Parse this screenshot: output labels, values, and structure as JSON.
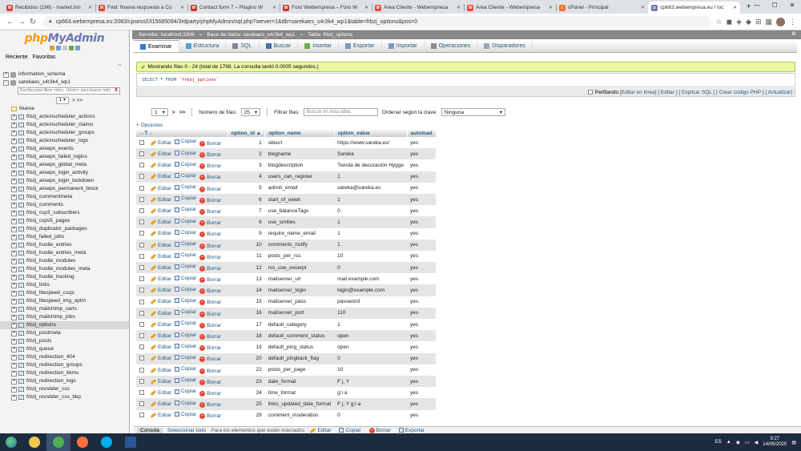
{
  "browser": {
    "tabs": [
      {
        "title": "Recibidos (196) - market.inn",
        "fav": "M",
        "color": "#d44638"
      },
      {
        "title": "Fwd: Nueva respuesta a Co",
        "fav": "M",
        "color": "#d44638"
      },
      {
        "title": "Contact form 7 – Plugins W",
        "fav": "W",
        "color": "#c0392b"
      },
      {
        "title": "Foro Webempresa – Foro W",
        "fav": "W",
        "color": "#c0392b"
      },
      {
        "title": "Área Cliente - Webempresa",
        "fav": "W",
        "color": "#e8493c"
      },
      {
        "title": "Área Cliente - Webempresa",
        "fav": "W",
        "color": "#e8493c"
      },
      {
        "title": "cPanel - Principal",
        "fav": "c",
        "color": "#ff6c2c"
      },
      {
        "title": "cp663.webempresa.eu / loc",
        "fav": "p",
        "color": "#6c78af",
        "active": true
      }
    ],
    "new_tab": "+",
    "url": "cp663.webempresa.eu:2083/cpsess5315685094/3rdparty/phpMyAdmin/sql.php?server=1&db=sarekaes_s4r3k4_wp1&table=frbzj_options&pos=0"
  },
  "sidebar": {
    "logo_php": "php",
    "logo_my": "MyAdmin",
    "tab_recent": "Reciente",
    "tab_fav": "Favoritas",
    "link_icon": "⇔",
    "db_info": "information_schema",
    "db_main": "sarekaes_s4r3k4_wp1",
    "filter_placeholder": "Escriba para filtrar estos, «Enter» para buscar todo",
    "filter_clear": "X",
    "page_value": "1",
    "page_next": "> >>",
    "new_label": "Nueva",
    "tables": [
      "frbzj_actionscheduler_actions",
      "frbzj_actionscheduler_claims",
      "frbzj_actionscheduler_groups",
      "frbzj_actionscheduler_logs",
      "frbzj_aiowps_events",
      "frbzj_aiowps_failed_logins",
      "frbzj_aiowps_global_meta",
      "frbzj_aiowps_login_activity",
      "frbzj_aiowps_login_lockdown",
      "frbzj_aiowps_permanent_block",
      "frbzj_commentmeta",
      "frbzj_comments",
      "frbzj_csp3_subscribers",
      "frbzj_cspv5_pages",
      "frbzj_duplicator_packages",
      "frbzj_failed_jobs",
      "frbzj_hustle_entries",
      "frbzj_hustle_entries_meta",
      "frbzj_hustle_modules",
      "frbzj_hustle_modules_meta",
      "frbzj_hustle_tracking",
      "frbzj_links",
      "frbzj_litespeed_cssjs",
      "frbzj_litespeed_img_optm",
      "frbzj_mailchimp_carts",
      "frbzj_mailchimp_jobs",
      "frbzj_options",
      "frbzj_postmeta",
      "frbzj_posts",
      "frbzj_queue",
      "frbzj_redirection_404",
      "frbzj_redirection_groups",
      "frbzj_redirection_items",
      "frbzj_redirection_logs",
      "frbzj_revslider_css",
      "frbzj_revslider_css_bkp"
    ],
    "selected_table": "frbzj_options"
  },
  "breadcrumb": {
    "server": "Servidor: localhost:3306",
    "db": "Base de datos: sarekaes_s4r3k4_wp1",
    "table": "Tabla: frbzj_options",
    "sep": "»",
    "gear": "⚙"
  },
  "menu": [
    {
      "label": "Examinar",
      "color": "#2e7bcf"
    },
    {
      "label": "Estructura",
      "color": "#5aa0d8"
    },
    {
      "label": "SQL",
      "color": "#7d8a99"
    },
    {
      "label": "Buscar",
      "color": "#4b6fa8"
    },
    {
      "label": "Insertar",
      "color": "#6ab04c"
    },
    {
      "label": "Exportar",
      "color": "#7d9bc1"
    },
    {
      "label": "Importar",
      "color": "#7d9bc1"
    },
    {
      "label": "Operaciones",
      "color": "#8c8c8c"
    },
    {
      "label": "Disparadores",
      "color": "#9aa9bc"
    }
  ],
  "success_msg": "Mostrando filas 0 - 24 (total de 1768, La consulta tardó 0.0005 segundos.)",
  "success_check": "✔",
  "sql": {
    "kw1": "SELECT",
    "star": "*",
    "kw2": "FROM",
    "table": "`frbzj_options`"
  },
  "toolbar": {
    "perfilando": "Perfilando",
    "edit_inline": "[Editar en línea]",
    "edit": "[ Editar ]",
    "explain": "[ Explicar SQL ]",
    "php": "[ Crear código PHP ]",
    "refresh": "[ Actualizar]"
  },
  "nav": {
    "page": "1",
    "next": ">",
    "last": ">>",
    "rows_label": "Número de filas:",
    "rows_value": "25",
    "filter_label": "Filtrar filas:",
    "filter_placeholder": "Buscar en esta tabla",
    "sort_label": "Ordenar según la clave:",
    "sort_value": "Ninguna"
  },
  "opciones": "+ Opciones",
  "columns": {
    "arrows": "←T→",
    "id": "option_id",
    "name": "option_name",
    "value": "option_value",
    "autoload": "autoload",
    "sort": "▲"
  },
  "actions": {
    "edit": "Editar",
    "copy": "Copiar",
    "delete": "Borrar"
  },
  "rows": [
    {
      "id": "1",
      "name": "siteurl",
      "value": "https://www.sareka.es/",
      "autoload": "yes"
    },
    {
      "id": "2",
      "name": "blogname",
      "value": "Sareka",
      "autoload": "yes"
    },
    {
      "id": "3",
      "name": "blogdescription",
      "value": "Tienda de decoración Hygge",
      "autoload": "yes"
    },
    {
      "id": "4",
      "name": "users_can_register",
      "value": "1",
      "autoload": "yes"
    },
    {
      "id": "5",
      "name": "admin_email",
      "value": "sareka@sareka.es",
      "autoload": "yes"
    },
    {
      "id": "6",
      "name": "start_of_week",
      "value": "1",
      "autoload": "yes"
    },
    {
      "id": "7",
      "name": "use_balanceTags",
      "value": "0",
      "autoload": "yes"
    },
    {
      "id": "8",
      "name": "use_smilies",
      "value": "1",
      "autoload": "yes"
    },
    {
      "id": "9",
      "name": "require_name_email",
      "value": "1",
      "autoload": "yes"
    },
    {
      "id": "10",
      "name": "comments_notify",
      "value": "1",
      "autoload": "yes"
    },
    {
      "id": "11",
      "name": "posts_per_rss",
      "value": "10",
      "autoload": "yes"
    },
    {
      "id": "12",
      "name": "rss_use_excerpt",
      "value": "0",
      "autoload": "yes"
    },
    {
      "id": "13",
      "name": "mailserver_url",
      "value": "mail.example.com",
      "autoload": "yes"
    },
    {
      "id": "14",
      "name": "mailserver_login",
      "value": "login@example.com",
      "autoload": "yes"
    },
    {
      "id": "15",
      "name": "mailserver_pass",
      "value": "password",
      "autoload": "yes"
    },
    {
      "id": "16",
      "name": "mailserver_port",
      "value": "110",
      "autoload": "yes"
    },
    {
      "id": "17",
      "name": "default_category",
      "value": "1",
      "autoload": "yes"
    },
    {
      "id": "18",
      "name": "default_comment_status",
      "value": "open",
      "autoload": "yes"
    },
    {
      "id": "19",
      "name": "default_ping_status",
      "value": "open",
      "autoload": "yes"
    },
    {
      "id": "20",
      "name": "default_pingback_flag",
      "value": "0",
      "autoload": "yes"
    },
    {
      "id": "22",
      "name": "posts_per_page",
      "value": "10",
      "autoload": "yes"
    },
    {
      "id": "23",
      "name": "date_format",
      "value": "F j, Y",
      "autoload": "yes"
    },
    {
      "id": "24",
      "name": "time_format",
      "value": "g:i a",
      "autoload": "yes"
    },
    {
      "id": "25",
      "name": "links_updated_date_format",
      "value": "F j, Y g:i a",
      "autoload": "yes"
    },
    {
      "id": "29",
      "name": "comment_moderation",
      "value": "0",
      "autoload": "yes"
    }
  ],
  "bottom": {
    "console": "Consola",
    "select_all": "Seleccionar todo",
    "marked": "Para los elementos que están marcados:",
    "edit": "Editar",
    "copy": "Copiar",
    "delete": "Borrar",
    "export": "Exportar"
  },
  "taskbar": {
    "lang": "ES",
    "time": "9:27",
    "date": "14/05/2020",
    "apps": [
      {
        "name": "explorer",
        "color": "#f2c94c"
      },
      {
        "name": "chrome",
        "color": "#4caf50",
        "active": true
      },
      {
        "name": "firefox",
        "color": "#ff7139"
      },
      {
        "name": "skype",
        "color": "#00aff0"
      },
      {
        "name": "word",
        "color": "#2b579a"
      }
    ]
  }
}
